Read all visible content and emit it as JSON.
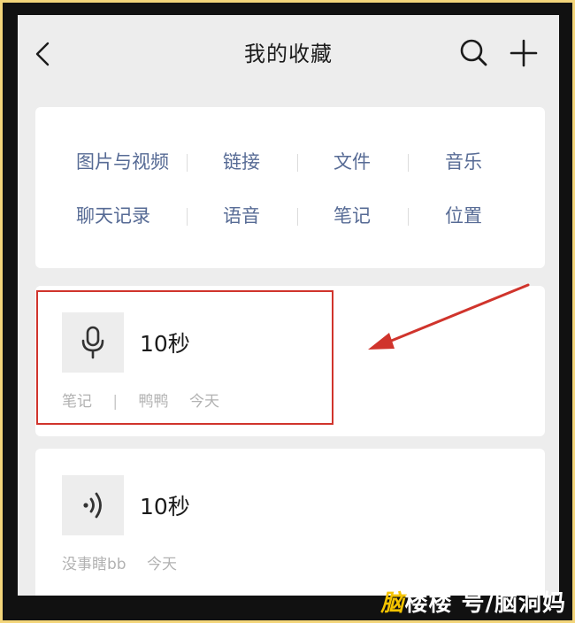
{
  "header": {
    "title": "我的收藏",
    "back_icon": "chevron-left-icon",
    "search_icon": "search-icon",
    "add_icon": "plus-icon"
  },
  "categories": {
    "row1": [
      "图片与视频",
      "链接",
      "文件",
      "音乐"
    ],
    "row2": [
      "聊天记录",
      "语音",
      "笔记",
      "位置"
    ]
  },
  "favorites": [
    {
      "icon": "microphone-icon",
      "title": "10秒",
      "meta": [
        "笔记",
        "|",
        "鸭鸭",
        "今天"
      ]
    },
    {
      "icon": "voice-audio-icon",
      "title": "10秒",
      "meta": [
        "没事瞎bb",
        "今天"
      ]
    }
  ],
  "annotation": {
    "color": "#d0342c"
  },
  "watermark": {
    "prefix": "脑",
    "text": "楼楼 号/脑洞妈"
  },
  "colors": {
    "accent_link": "#576b95",
    "background": "#ededed",
    "frame_border": "#f3d57a"
  }
}
